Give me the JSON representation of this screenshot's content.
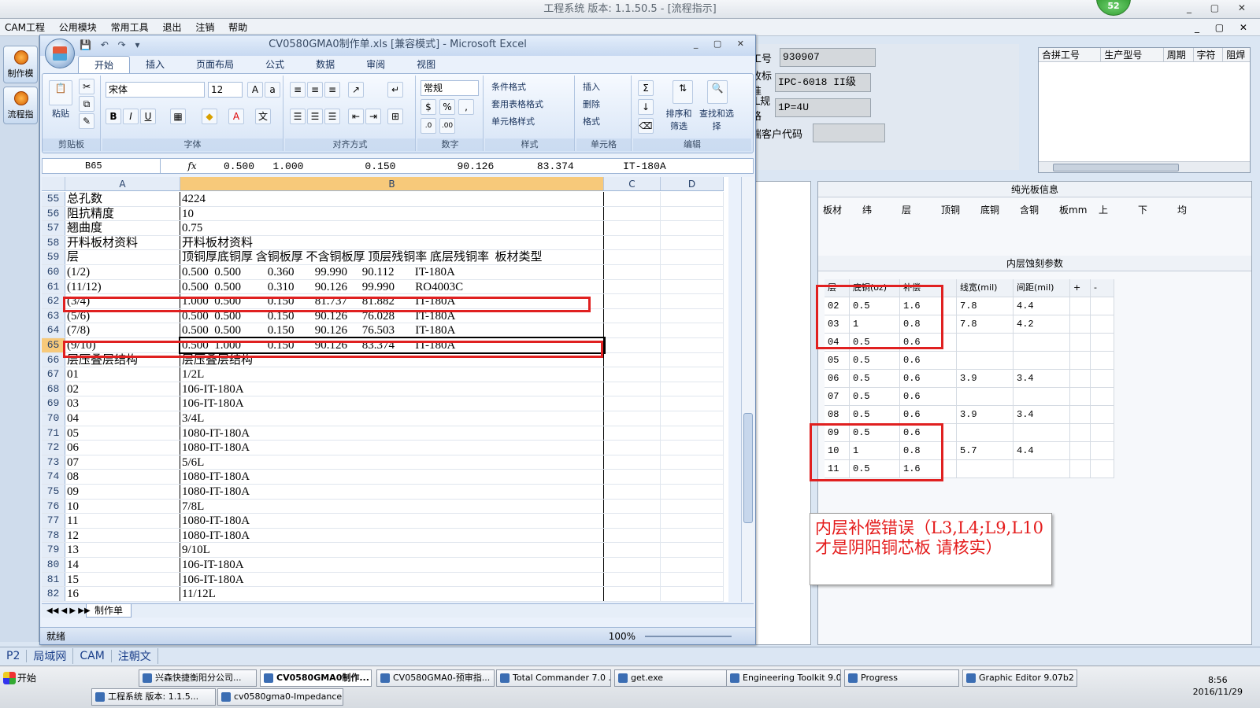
{
  "app": {
    "title": "工程系统   版本: 1.1.50.5 - [流程指示]",
    "badge": "52",
    "menu": [
      "CAM工程",
      "公用模块",
      "常用工具",
      "退出",
      "注销",
      "帮助"
    ],
    "left_buttons": [
      "制作模",
      "流程指"
    ]
  },
  "info_panel": {
    "fields": [
      {
        "label": "工号",
        "value": "930907"
      },
      {
        "label": "收标准",
        "value": "IPC-6018 II级"
      },
      {
        "label": "IL规格",
        "value": "1P=4U"
      },
      {
        "label": "端客户代码",
        "value": ""
      }
    ],
    "combo_headers": [
      "合拼工号",
      "生产型号",
      "周期",
      "字符",
      "阻焊"
    ]
  },
  "right_panel": {
    "pure_title": "纯光板信息",
    "pure_headers": [
      "板材",
      "纬",
      "层",
      "顶铜",
      "底铜",
      "含铜",
      "板mm",
      "上",
      "下",
      "均"
    ],
    "etch_title": "内层蚀刻参数",
    "etch_headers": [
      "层",
      "底铜(oz)",
      "补偿",
      "线宽(mil)",
      "间距(mil)",
      "+",
      "-"
    ],
    "etch_rows": [
      [
        "02",
        "0.5",
        "1.6",
        "7.8",
        "4.4"
      ],
      [
        "03",
        "1",
        "0.8",
        "7.8",
        "4.2"
      ],
      [
        "04",
        "0.5",
        "0.6",
        "",
        ""
      ],
      [
        "05",
        "0.5",
        "0.6",
        "",
        ""
      ],
      [
        "06",
        "0.5",
        "0.6",
        "3.9",
        "3.4"
      ],
      [
        "07",
        "0.5",
        "0.6",
        "",
        ""
      ],
      [
        "08",
        "0.5",
        "0.6",
        "3.9",
        "3.4"
      ],
      [
        "09",
        "0.5",
        "0.6",
        "",
        ""
      ],
      [
        "10",
        "1",
        "0.8",
        "5.7",
        "4.4"
      ],
      [
        "11",
        "0.5",
        "1.6",
        "",
        ""
      ]
    ]
  },
  "note": "内层补偿错误（L3,L4;L9,L10才是阴阳铜芯板   请核实）",
  "excel": {
    "title": "CV0580GMA0制作单.xls [兼容模式] - Microsoft Excel",
    "tabs": [
      "开始",
      "插入",
      "页面布局",
      "公式",
      "数据",
      "审阅",
      "视图"
    ],
    "ribbon": {
      "clipboard": "剪贴板",
      "paste": "粘贴",
      "font_group": "字体",
      "font_name": "宋体",
      "font_size": "12",
      "align_group": "对齐方式",
      "number_group": "数字",
      "number_format": "常规",
      "styles_group": "样式",
      "cond_format": "条件格式",
      "table_format": "套用表格格式",
      "cell_style": "单元格样式",
      "cells_group": "单元格",
      "insert": "插入",
      "delete": "删除",
      "format": "格式",
      "edit_group": "编辑",
      "sort": "排序和筛选",
      "find": "查找和选择"
    },
    "name_box": "B65",
    "fx": "fx",
    "formula": "0.500   1.000          0.150          90.126       83.374        IT-180A",
    "columns": [
      "A",
      "B",
      "C",
      "D"
    ],
    "rows": [
      {
        "n": "55",
        "a": "总孔数",
        "b": "4224"
      },
      {
        "n": "56",
        "a": "阻抗精度",
        "b": "10"
      },
      {
        "n": "57",
        "a": "翘曲度",
        "b": "0.75"
      },
      {
        "n": "58",
        "a": "开料板材资料",
        "b": "开料板材资料"
      },
      {
        "n": "59",
        "a": "层",
        "b": "顶铜厚底铜厚 含铜板厚 不含铜板厚 顶层残铜率 底层残铜率  板材类型"
      },
      {
        "n": "60",
        "a": "(1/2)",
        "b": "0.500  0.500         0.360       99.990     90.112       IT-180A"
      },
      {
        "n": "61",
        "a": "(11/12)",
        "b": "0.500  0.500         0.310       90.126     99.990       RO4003C"
      },
      {
        "n": "62",
        "a": "(3/4)",
        "b": "1.000  0.500         0.150       81.737     81.882       IT-180A"
      },
      {
        "n": "63",
        "a": "(5/6)",
        "b": "0.500  0.500         0.150       90.126     76.028       IT-180A"
      },
      {
        "n": "64",
        "a": "(7/8)",
        "b": "0.500  0.500         0.150       90.126     76.503       IT-180A"
      },
      {
        "n": "65",
        "a": "(9/10)",
        "b": "0.500  1.000         0.150       90.126     83.374       IT-180A"
      },
      {
        "n": "66",
        "a": "层压叠层结构",
        "b": "层压叠层结构"
      },
      {
        "n": "67",
        "a": "01",
        "b": "1/2L"
      },
      {
        "n": "68",
        "a": "02",
        "b": "106-IT-180A"
      },
      {
        "n": "69",
        "a": "03",
        "b": "106-IT-180A"
      },
      {
        "n": "70",
        "a": "04",
        "b": "3/4L"
      },
      {
        "n": "71",
        "a": "05",
        "b": "1080-IT-180A"
      },
      {
        "n": "72",
        "a": "06",
        "b": "1080-IT-180A"
      },
      {
        "n": "73",
        "a": "07",
        "b": "5/6L"
      },
      {
        "n": "74",
        "a": "08",
        "b": "1080-IT-180A"
      },
      {
        "n": "75",
        "a": "09",
        "b": "1080-IT-180A"
      },
      {
        "n": "76",
        "a": "10",
        "b": "7/8L"
      },
      {
        "n": "77",
        "a": "11",
        "b": "1080-IT-180A"
      },
      {
        "n": "78",
        "a": "12",
        "b": "1080-IT-180A"
      },
      {
        "n": "79",
        "a": "13",
        "b": "9/10L"
      },
      {
        "n": "80",
        "a": "14",
        "b": "106-IT-180A"
      },
      {
        "n": "81",
        "a": "15",
        "b": "106-IT-180A"
      },
      {
        "n": "82",
        "a": "16",
        "b": "11/12L"
      }
    ],
    "sheet_tab": "制作单",
    "status": "就绪",
    "zoom": "100%"
  },
  "bottom_tabs": [
    "P2",
    "局域网",
    "CAM",
    "注朝文"
  ],
  "taskbar": {
    "start": "开始",
    "items": [
      {
        "label": "兴森快捷衡阳分公司...",
        "active": false
      },
      {
        "label": "CV0580GMA0制作...",
        "active": true
      },
      {
        "label": "CV0580GMA0-预审指...",
        "active": false
      },
      {
        "label": "Total Commander 7.0 ...",
        "active": false
      },
      {
        "label": "get.exe",
        "active": false
      },
      {
        "label": "Engineering Toolkit 9.0...",
        "active": false
      },
      {
        "label": "Progress",
        "active": false
      },
      {
        "label": "Graphic Editor 9.07b2 ...",
        "active": false
      },
      {
        "label": "工程系统  版本: 1.1.5...",
        "active": false
      },
      {
        "label": "cv0580gma0-Impedance...",
        "active": false
      }
    ],
    "time": "8:56",
    "date": "2016/11/29"
  }
}
